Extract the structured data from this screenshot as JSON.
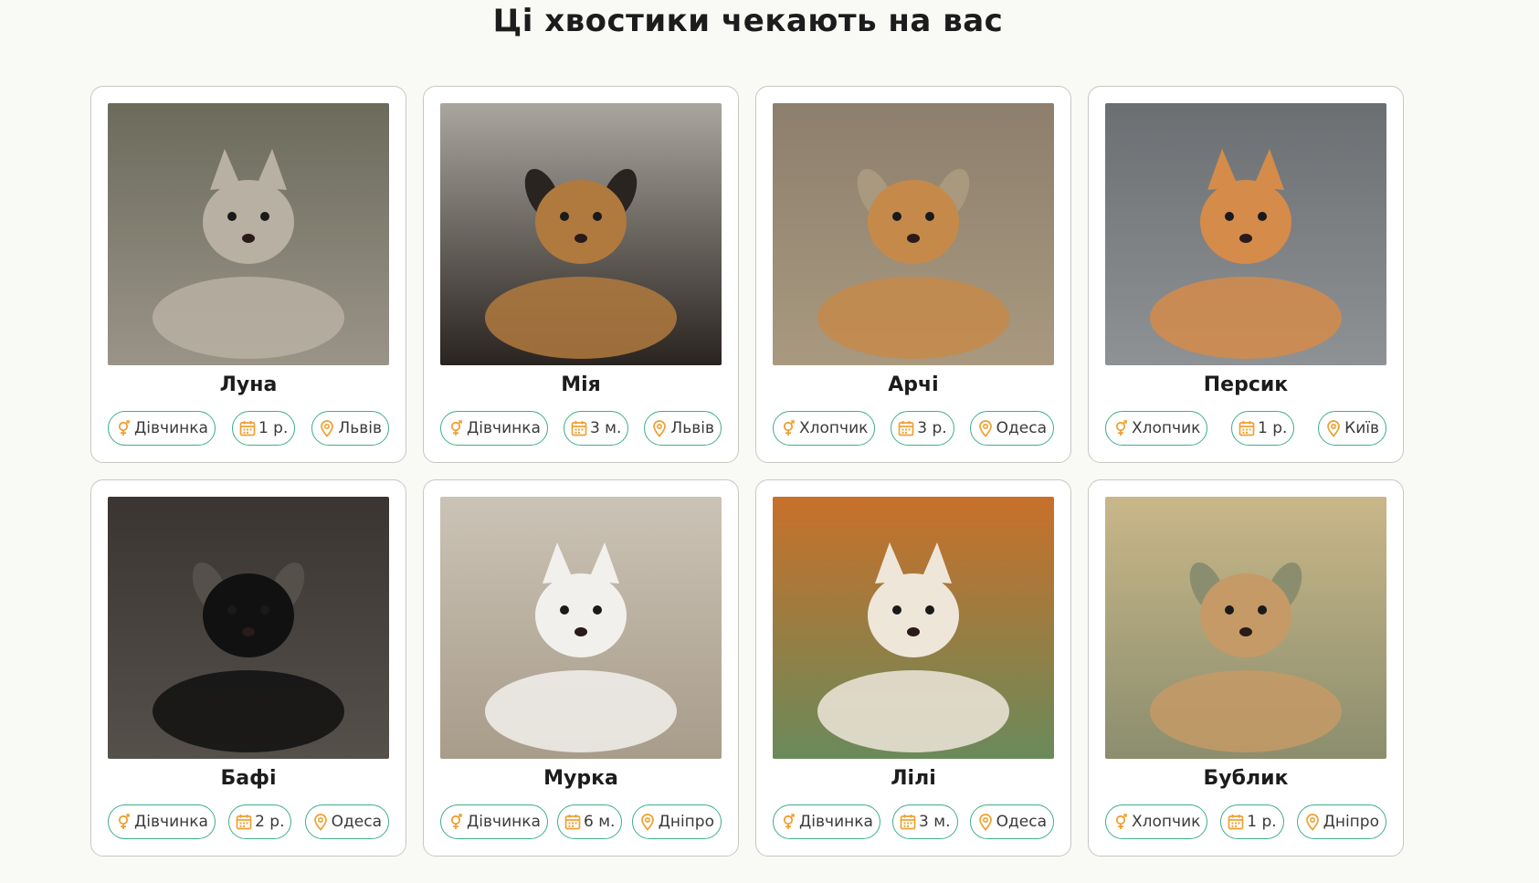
{
  "section": {
    "title": "Ці хвостики чекають на вас"
  },
  "colors": {
    "tag_border": "#3fae8e",
    "icon": "#f0a030",
    "card_border": "#c8c8c2"
  },
  "icons": {
    "gender": "gender-icon",
    "age": "calendar-icon",
    "location": "location-pin-icon"
  },
  "pets": [
    {
      "name": "Луна",
      "gender": "Дівчинка",
      "age": "1 р.",
      "city": "Львів",
      "photo": "tabby-cat-lying",
      "palette": [
        "#6b6b5c",
        "#9a9488",
        "#b8b0a2"
      ]
    },
    {
      "name": "Мія",
      "gender": "Дівчинка",
      "age": "3 м.",
      "city": "Львів",
      "photo": "shepherd-puppy",
      "palette": [
        "#a9a69e",
        "#2a2420",
        "#b07a3e"
      ]
    },
    {
      "name": "Арчі",
      "gender": "Хлопчик",
      "age": "3 р.",
      "city": "Одеса",
      "photo": "ginger-dog-on-sand",
      "palette": [
        "#8d7f6d",
        "#a8997f",
        "#c58a4a"
      ]
    },
    {
      "name": "Персик",
      "gender": "Хлопчик",
      "age": "1 р.",
      "city": "Київ",
      "photo": "ginger-cat-on-step",
      "palette": [
        "#6b6f72",
        "#8e9295",
        "#d58b4a"
      ]
    },
    {
      "name": "Бафі",
      "gender": "Дівчинка",
      "age": "2 р.",
      "city": "Одеса",
      "photo": "black-white-dog",
      "palette": [
        "#3a3532",
        "#55504a",
        "#111111"
      ]
    },
    {
      "name": "Мурка",
      "gender": "Дівчинка",
      "age": "6 м.",
      "city": "Дніпро",
      "photo": "white-kitten-on-sofa",
      "palette": [
        "#cbc3b6",
        "#a89c8a",
        "#f2f0ec"
      ]
    },
    {
      "name": "Лілі",
      "gender": "Дівчинка",
      "age": "3 м.",
      "city": "Одеса",
      "photo": "siamese-kitten",
      "palette": [
        "#c8702a",
        "#6a8a5a",
        "#efe6da"
      ]
    },
    {
      "name": "Бублик",
      "gender": "Хлопчик",
      "age": "1 р.",
      "city": "Дніпро",
      "photo": "fawn-puppy-big-ears",
      "palette": [
        "#c9b789",
        "#8b8e6e",
        "#c59a66"
      ]
    }
  ]
}
